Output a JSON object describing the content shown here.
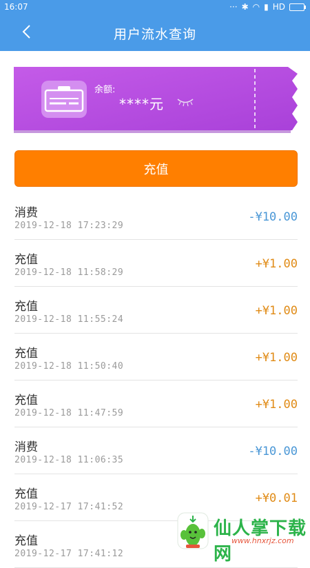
{
  "status_bar": {
    "time": "16:07",
    "network": "HD"
  },
  "header": {
    "title": "用户流水查询"
  },
  "balance_card": {
    "label": "余额:",
    "value": "****元"
  },
  "recharge_button": {
    "label": "充值"
  },
  "transactions": [
    {
      "type": "消费",
      "time": "2019-12-18  17:23:29",
      "amount": "-¥10.00",
      "kind": "neg"
    },
    {
      "type": "充值",
      "time": "2019-12-18  11:58:29",
      "amount": "+¥1.00",
      "kind": "pos"
    },
    {
      "type": "充值",
      "time": "2019-12-18  11:55:24",
      "amount": "+¥1.00",
      "kind": "pos"
    },
    {
      "type": "充值",
      "time": "2019-12-18  11:50:40",
      "amount": "+¥1.00",
      "kind": "pos"
    },
    {
      "type": "充值",
      "time": "2019-12-18  11:47:59",
      "amount": "+¥1.00",
      "kind": "pos"
    },
    {
      "type": "消费",
      "time": "2019-12-18  11:06:35",
      "amount": "-¥10.00",
      "kind": "neg"
    },
    {
      "type": "充值",
      "time": "2019-12-17  17:41:52",
      "amount": "+¥0.01",
      "kind": "pos"
    },
    {
      "type": "充值",
      "time": "2019-12-17  17:41:12",
      "amount": "",
      "kind": "pos"
    }
  ],
  "watermark": {
    "text": "仙人掌下载网",
    "url": "www.hnxrjz.com"
  },
  "colors": {
    "primary": "#4a9be8",
    "accent": "#ff7f00",
    "card": "#b64fe0",
    "negative": "#4a97d6",
    "positive": "#e08b16"
  }
}
